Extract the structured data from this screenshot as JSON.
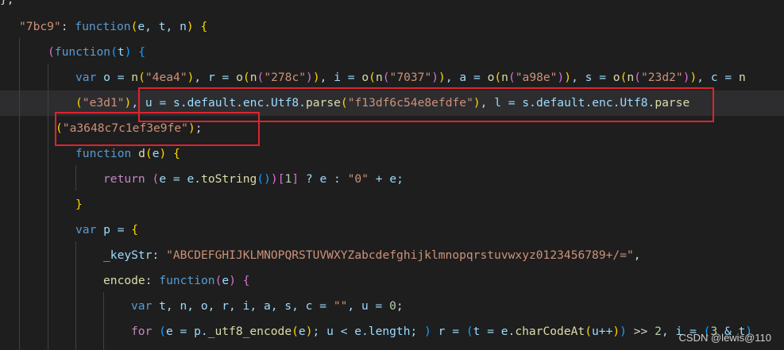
{
  "lines": [
    {
      "tokens": [
        {
          "t": "},",
          "c": "p"
        }
      ]
    },
    {
      "tokens": [
        {
          "t": "\"7bc9\"",
          "c": "str"
        },
        {
          "t": ": ",
          "c": "p"
        },
        {
          "t": "function",
          "c": "kw"
        },
        {
          "t": "(",
          "c": "b1"
        },
        {
          "t": "e, t, n",
          "c": "var"
        },
        {
          "t": ")",
          "c": "b1"
        },
        {
          "t": " {",
          "c": "b1"
        }
      ]
    },
    {
      "tokens": [
        {
          "t": "(",
          "c": "b2"
        },
        {
          "t": "function",
          "c": "kw"
        },
        {
          "t": "(",
          "c": "b3"
        },
        {
          "t": "t",
          "c": "var"
        },
        {
          "t": ")",
          "c": "b3"
        },
        {
          "t": " {",
          "c": "b3"
        }
      ]
    },
    {
      "tokens": [
        {
          "t": "var",
          "c": "kw"
        },
        {
          "t": " o = ",
          "c": "var"
        },
        {
          "t": "n",
          "c": "fn"
        },
        {
          "t": "(",
          "c": "b1"
        },
        {
          "t": "\"4ea4\"",
          "c": "str"
        },
        {
          "t": ")",
          "c": "b1"
        },
        {
          "t": ", r = ",
          "c": "var"
        },
        {
          "t": "o",
          "c": "fn"
        },
        {
          "t": "(",
          "c": "b1"
        },
        {
          "t": "n",
          "c": "fn"
        },
        {
          "t": "(",
          "c": "b2"
        },
        {
          "t": "\"278c\"",
          "c": "str"
        },
        {
          "t": ")",
          "c": "b2"
        },
        {
          "t": ")",
          "c": "b1"
        },
        {
          "t": ", i = ",
          "c": "var"
        },
        {
          "t": "o",
          "c": "fn"
        },
        {
          "t": "(",
          "c": "b1"
        },
        {
          "t": "n",
          "c": "fn"
        },
        {
          "t": "(",
          "c": "b2"
        },
        {
          "t": "\"7037\"",
          "c": "str"
        },
        {
          "t": ")",
          "c": "b2"
        },
        {
          "t": ")",
          "c": "b1"
        },
        {
          "t": ", a = ",
          "c": "var"
        },
        {
          "t": "o",
          "c": "fn"
        },
        {
          "t": "(",
          "c": "b1"
        },
        {
          "t": "n",
          "c": "fn"
        },
        {
          "t": "(",
          "c": "b2"
        },
        {
          "t": "\"a98e\"",
          "c": "str"
        },
        {
          "t": ")",
          "c": "b2"
        },
        {
          "t": ")",
          "c": "b1"
        },
        {
          "t": ", s = ",
          "c": "var"
        },
        {
          "t": "o",
          "c": "fn"
        },
        {
          "t": "(",
          "c": "b1"
        },
        {
          "t": "n",
          "c": "fn"
        },
        {
          "t": "(",
          "c": "b2"
        },
        {
          "t": "\"23d2\"",
          "c": "str"
        },
        {
          "t": ")",
          "c": "b2"
        },
        {
          "t": ")",
          "c": "b1"
        },
        {
          "t": ", c = ",
          "c": "var"
        },
        {
          "t": "n",
          "c": "fn"
        }
      ]
    },
    {
      "tokens": [
        {
          "t": "(",
          "c": "b1"
        },
        {
          "t": "\"e3d1\"",
          "c": "str"
        },
        {
          "t": ")",
          "c": "b1"
        },
        {
          "t": ", u = s.default.enc.Utf8.",
          "c": "var"
        },
        {
          "t": "parse",
          "c": "fn"
        },
        {
          "t": "(",
          "c": "b1"
        },
        {
          "t": "\"f13df6c54e8efdfe\"",
          "c": "str"
        },
        {
          "t": ")",
          "c": "b1"
        },
        {
          "t": ", l = s.default.enc.Utf8.",
          "c": "var"
        },
        {
          "t": "parse",
          "c": "fn"
        }
      ]
    },
    {
      "tokens": [
        {
          "t": "(",
          "c": "b1"
        },
        {
          "t": "\"a3648c7c1ef3e9fe\"",
          "c": "str"
        },
        {
          "t": ")",
          "c": "b1"
        },
        {
          "t": ";",
          "c": "p"
        }
      ]
    },
    {
      "tokens": [
        {
          "t": "function",
          "c": "kw"
        },
        {
          "t": " ",
          "c": "p"
        },
        {
          "t": "d",
          "c": "fn"
        },
        {
          "t": "(",
          "c": "b1"
        },
        {
          "t": "e",
          "c": "var"
        },
        {
          "t": ")",
          "c": "b1"
        },
        {
          "t": " {",
          "c": "b1"
        }
      ]
    },
    {
      "tokens": [
        {
          "t": "return",
          "c": "ctl"
        },
        {
          "t": " ",
          "c": "p"
        },
        {
          "t": "(",
          "c": "b2"
        },
        {
          "t": "e = e.",
          "c": "var"
        },
        {
          "t": "toString",
          "c": "fn"
        },
        {
          "t": "(",
          "c": "b3"
        },
        {
          "t": ")",
          "c": "b3"
        },
        {
          "t": ")",
          "c": "b2"
        },
        {
          "t": "[",
          "c": "b2"
        },
        {
          "t": "1",
          "c": "num"
        },
        {
          "t": "]",
          "c": "b2"
        },
        {
          "t": " ? e : ",
          "c": "var"
        },
        {
          "t": "\"0\"",
          "c": "str"
        },
        {
          "t": " + e;",
          "c": "var"
        }
      ]
    },
    {
      "tokens": [
        {
          "t": "}",
          "c": "b1"
        }
      ]
    },
    {
      "tokens": [
        {
          "t": "var",
          "c": "kw"
        },
        {
          "t": " p = ",
          "c": "var"
        },
        {
          "t": "{",
          "c": "b1"
        }
      ]
    },
    {
      "tokens": [
        {
          "t": "_keyStr",
          "c": "var"
        },
        {
          "t": ": ",
          "c": "p"
        },
        {
          "t": "\"ABCDEFGHIJKLMNOPQRSTUVWXYZabcdefghijklmnopqrstuvwxyz0123456789+/=\"",
          "c": "str"
        },
        {
          "t": ",",
          "c": "p"
        }
      ]
    },
    {
      "tokens": [
        {
          "t": "encode",
          "c": "fn"
        },
        {
          "t": ": ",
          "c": "p"
        },
        {
          "t": "function",
          "c": "kw"
        },
        {
          "t": "(",
          "c": "b2"
        },
        {
          "t": "e",
          "c": "var"
        },
        {
          "t": ")",
          "c": "b2"
        },
        {
          "t": " {",
          "c": "b2"
        }
      ]
    },
    {
      "tokens": [
        {
          "t": "var",
          "c": "kw"
        },
        {
          "t": " t, n, o, r, i, a, s, c = ",
          "c": "var"
        },
        {
          "t": "\"\"",
          "c": "str"
        },
        {
          "t": ", u = ",
          "c": "var"
        },
        {
          "t": "0",
          "c": "num"
        },
        {
          "t": ";",
          "c": "p"
        }
      ]
    },
    {
      "tokens": [
        {
          "t": "for",
          "c": "ctl"
        },
        {
          "t": " ",
          "c": "p"
        },
        {
          "t": "(",
          "c": "b3"
        },
        {
          "t": "e = p.",
          "c": "var"
        },
        {
          "t": "_utf8_encode",
          "c": "fn"
        },
        {
          "t": "(",
          "c": "b1"
        },
        {
          "t": "e",
          "c": "var"
        },
        {
          "t": ")",
          "c": "b1"
        },
        {
          "t": "; u < e.length; ",
          "c": "var"
        },
        {
          "t": ")",
          "c": "b3"
        },
        {
          "t": " r = ",
          "c": "var"
        },
        {
          "t": "(",
          "c": "b3"
        },
        {
          "t": "t = e.",
          "c": "var"
        },
        {
          "t": "charCodeAt",
          "c": "fn"
        },
        {
          "t": "(",
          "c": "b1"
        },
        {
          "t": "u++",
          "c": "var"
        },
        {
          "t": ")",
          "c": "b1"
        },
        {
          "t": ")",
          "c": "b3"
        },
        {
          "t": " >> ",
          "c": "p"
        },
        {
          "t": "2",
          "c": "num"
        },
        {
          "t": ", i = ",
          "c": "var"
        },
        {
          "t": "(",
          "c": "b3"
        },
        {
          "t": "3",
          "c": "num"
        },
        {
          "t": " & t",
          "c": "var"
        },
        {
          "t": ")",
          "c": "b3"
        }
      ]
    }
  ],
  "watermark": "CSDN @lewis@110"
}
